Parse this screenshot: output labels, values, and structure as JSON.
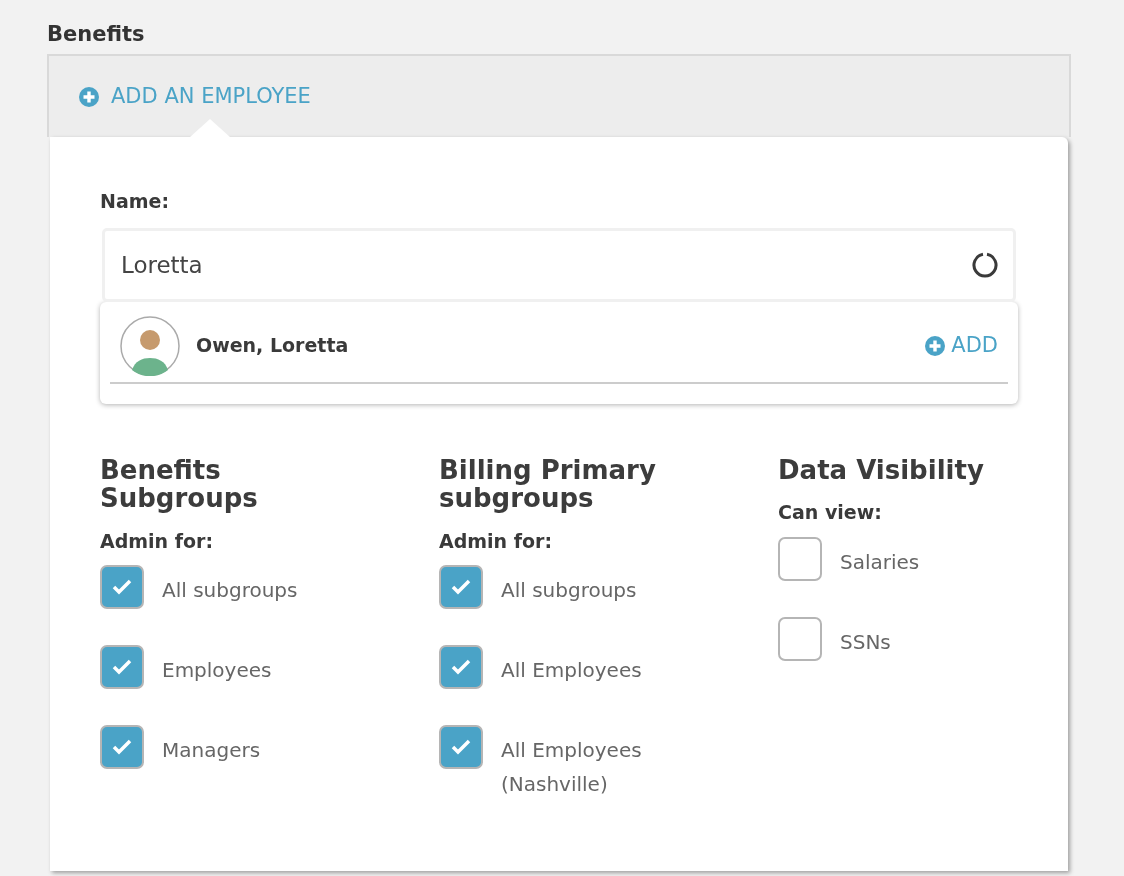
{
  "section_title": "Benefits",
  "add_link": {
    "label": "ADD AN EMPLOYEE"
  },
  "name_field": {
    "label": "Name:",
    "value": "Loretta",
    "loading": true
  },
  "suggestions": [
    {
      "name": "Owen, Loretta",
      "action": "ADD"
    }
  ],
  "columns": [
    {
      "title": "Benefits Subgroups",
      "subtitle": "Admin for:",
      "options": [
        {
          "label": "All subgroups",
          "checked": true
        },
        {
          "label": "Employees",
          "checked": true
        },
        {
          "label": "Managers",
          "checked": true
        }
      ]
    },
    {
      "title": "Billing Primary subgroups",
      "subtitle": "Admin for:",
      "options": [
        {
          "label": "All subgroups",
          "checked": true
        },
        {
          "label": "All Employees",
          "checked": true
        },
        {
          "label": "All Employees (Nashville)",
          "checked": true
        }
      ]
    },
    {
      "title": "Data Visibility",
      "subtitle": "Can view:",
      "options": [
        {
          "label": "Salaries",
          "checked": false
        },
        {
          "label": "SSNs",
          "checked": false
        }
      ]
    }
  ]
}
